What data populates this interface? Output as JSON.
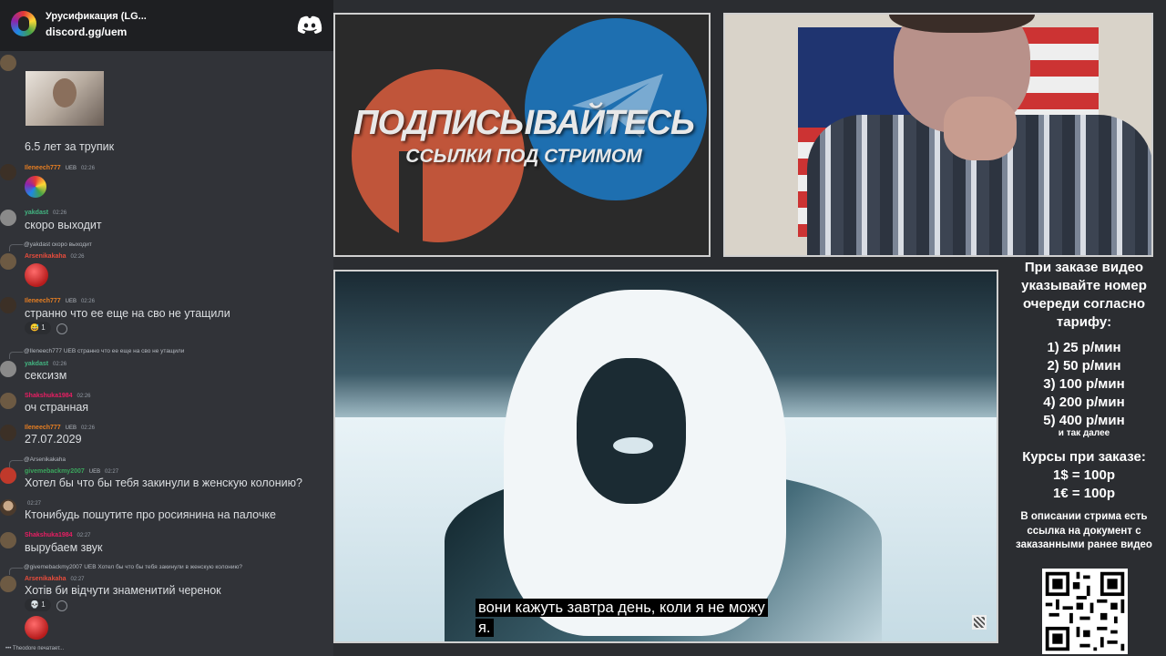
{
  "discord": {
    "server_name": "Урусификация (LG...",
    "invite": "discord.gg/uem"
  },
  "chat": {
    "first_text": "6.5 лет за трупик",
    "messages": [
      {
        "user": "Ileneech777",
        "badge": "UEB",
        "time": "02:26",
        "text": ""
      },
      {
        "user": "yakdast",
        "time": "02:26",
        "text": "скоро выходит"
      },
      {
        "reply": "@yakdast скоро выходит",
        "user": "Arsenikakaha",
        "time": "02:26",
        "text": ""
      },
      {
        "user": "Ileneech777",
        "badge": "UEB",
        "time": "02:26",
        "text": "странно что ее еще на сво не утащили",
        "reaction": "1"
      },
      {
        "reply": "@Ileneech777 UEB странно что ее еще на сво не утащили",
        "user": "yakdast",
        "time": "02:26",
        "text": "сексизм"
      },
      {
        "user": "Shakshuka1984",
        "time": "02:26",
        "text": "оч странная"
      },
      {
        "user": "Ileneech777",
        "badge": "UEB",
        "time": "02:26",
        "text": "27.07.2029"
      },
      {
        "reply": "@Arsenikakaha",
        "user": "givemebackmy2007",
        "badge": "UEB",
        "time": "02:27",
        "text": "Хотел бы что бы тебя закинули в женскую колонию?"
      },
      {
        "user": "",
        "time": "02:27",
        "text": "Ктонибудь пошутите про росиянина на палочке"
      },
      {
        "user": "Shakshuka1984",
        "time": "02:27",
        "text": "вырубаем звук"
      },
      {
        "reply": "@givemebackmy2007 UEB Хотел бы что бы тебя закинули в женскую колонию?",
        "user": "Arsenikakaha",
        "time": "02:27",
        "text": "Хотів би відчути знаменитий черенок",
        "reaction": "1"
      }
    ],
    "typing": "Theodore печатает..."
  },
  "promo": {
    "title": "ПОДПИСЫВАЙТЕСЬ",
    "subtitle": "ССЫЛКИ ПОД СТРИМОМ",
    "colors": {
      "patreon": "#c0553a",
      "telegram": "#1e6fb0"
    }
  },
  "video": {
    "subtitle_line1": "вони кажуть завтра день, коли я не можу",
    "subtitle_line2": "я."
  },
  "info": {
    "intro": "При заказе видео указывайте номер очереди согласно тарифу:",
    "tariffs": [
      "1) 25 р/мин",
      "2) 50 р/мин",
      "3) 100 р/мин",
      "4) 200 р/мин",
      "5) 400 р/мин"
    ],
    "tariff_more": "и так далее",
    "courses_title": "Курсы при заказе:",
    "courses": [
      "1$ = 100р",
      "1€ = 100р"
    ],
    "doc_note": "В описании стрима есть ссылка на документ с заказанными ранее видео"
  }
}
